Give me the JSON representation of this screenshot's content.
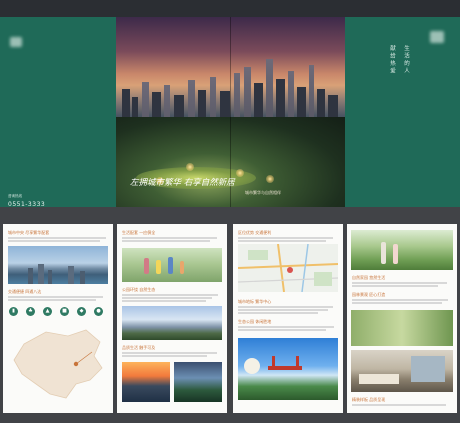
{
  "cover": {
    "slogan": "左拥城市繁华 右享自然新居",
    "slogan_sub": "城市繁华与自然相伴",
    "hotline_label": "咨询热线",
    "hotline": "0551-3333"
  },
  "flap": {
    "vertical_line1": "献给热爱",
    "vertical_line2": "生活的人"
  },
  "pages": {
    "p1": {
      "heading1": "城市中央 尽享繁华配套",
      "heading2": "交通便捷 四通八达",
      "icons": [
        "building-icon",
        "tree-icon",
        "bank-icon",
        "mall-icon",
        "school-icon",
        "park-icon"
      ]
    },
    "p2": {
      "heading1": "生活配套 一应俱全",
      "heading2": "公园环绕 自然生态",
      "heading3": "品质生活 触手可及"
    },
    "p3": {
      "heading1": "区位优势 交通便利",
      "heading2": "城市地标 繁华中心",
      "heading3": "生态公园 休闲胜地"
    },
    "p4": {
      "heading1": "自然家园 悠然生活",
      "heading2": "园林景观 匠心打造",
      "heading3": "精装样板 品质呈现"
    }
  },
  "colors": {
    "brand_green": "#1f6a58",
    "accent_orange": "#c8743a"
  }
}
